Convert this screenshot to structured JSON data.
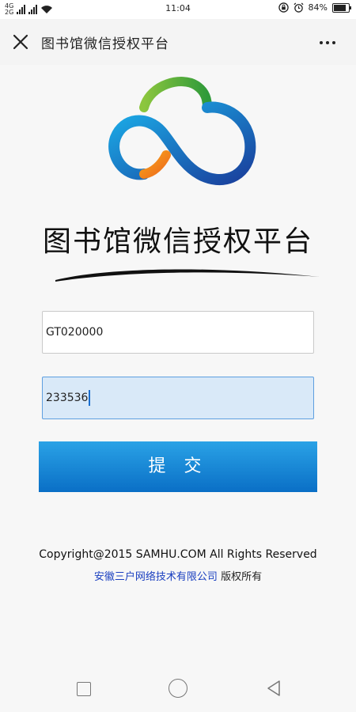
{
  "status_bar": {
    "network_top": "4G",
    "network_bottom": "2G",
    "time": "11:04",
    "battery": "84%",
    "battery_level": 0.84
  },
  "nav": {
    "title": "图书馆微信授权平台"
  },
  "brand": {
    "title": "图书馆微信授权平台"
  },
  "form": {
    "username_value": "GT020000",
    "password_value": "233536",
    "submit_label": "提 交"
  },
  "footer": {
    "copyright": "Copyright@2015 SAMHU.COM All Rights Reserved",
    "company": "安徽三户网络技术有限公司",
    "rights": "版权所有"
  },
  "colors": {
    "button_top": "#2aa2e6",
    "button_bottom": "#0a6fc6",
    "link": "#1a3fc0",
    "focus_bg": "#d9e9f8"
  }
}
